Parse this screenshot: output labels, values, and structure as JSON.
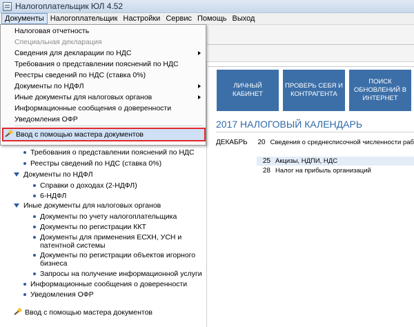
{
  "window": {
    "title": "Налогоплательщик ЮЛ 4.52"
  },
  "menubar": {
    "items": [
      "Документы",
      "Налогоплательщик",
      "Настройки",
      "Сервис",
      "Помощь",
      "Выход"
    ]
  },
  "tiles": [
    {
      "label": "ЛИЧНЫЙ КАБИНЕТ"
    },
    {
      "label": "ПРОВЕРЬ СЕБЯ И КОНТРАГЕНТА"
    },
    {
      "label": "ПОИСК ОБНОВЛЕНИЙ В ИНТЕРНЕТ"
    }
  ],
  "calendar": {
    "title": "2017  НАЛОГОВЫЙ КАЛЕНДАРЬ",
    "month": "ДЕКАБРЬ",
    "entries": [
      {
        "day": "20",
        "text": "Сведения о среднесписочной численности раб"
      },
      {
        "day": "25",
        "text": "Акцизы, НДПИ, НДС"
      },
      {
        "day": "28",
        "text": "Налог на прибыль организаций"
      }
    ]
  },
  "dropdown": {
    "items": [
      {
        "label": "Налоговая отчетность",
        "disabled": false,
        "submenu": false
      },
      {
        "label": "Специальная декларация",
        "disabled": true,
        "submenu": false
      },
      {
        "label": "Сведения для декларации по НДС",
        "disabled": false,
        "submenu": true
      },
      {
        "label": "Требования о представлении пояснений по НДС",
        "disabled": false,
        "submenu": false
      },
      {
        "label": "Реестры сведений по НДС (ставка 0%)",
        "disabled": false,
        "submenu": false
      },
      {
        "label": "Документы по НДФЛ",
        "disabled": false,
        "submenu": true
      },
      {
        "label": "Иные документы для налоговых органов",
        "disabled": false,
        "submenu": true
      },
      {
        "label": "Информационные сообщения о доверенности",
        "disabled": false,
        "submenu": false
      },
      {
        "label": "Уведомления ОФР",
        "disabled": false,
        "submenu": false
      }
    ],
    "wizard": "Ввод с помощью мастера документов"
  },
  "tree": {
    "items": [
      {
        "label": "Требования о представлении пояснений по НДС"
      },
      {
        "label": "Реестры сведений по НДС (ставка 0%)"
      },
      {
        "label": "Документы по НДФЛ"
      },
      {
        "label": "Справки о доходах (2-НДФЛ)"
      },
      {
        "label": "6-НДФЛ"
      },
      {
        "label": "Иные документы для налоговых органов"
      },
      {
        "label": "Документы по учету налогоплательщика"
      },
      {
        "label": "Документы по регистрации ККТ"
      },
      {
        "label": "Документы для применения ЕСХН, УСН и"
      },
      {
        "label": "патентной системы"
      },
      {
        "label": "Документы по регистрации объектов игорного"
      },
      {
        "label": "бизнеса"
      },
      {
        "label": "Запросы на получение информационной услуги"
      },
      {
        "label": "Информационные сообщения о доверенности"
      },
      {
        "label": "Уведомления ОФР"
      },
      {
        "label": "Ввод с помощью мастера документов"
      }
    ]
  }
}
